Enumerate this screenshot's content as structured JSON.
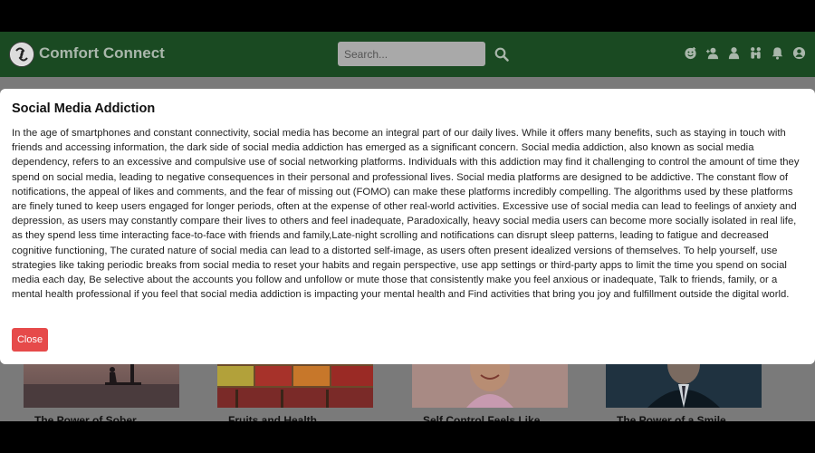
{
  "navbar": {
    "brand": "Comfort Connect",
    "search_placeholder": "Search...",
    "icons": [
      "emoji-icon",
      "add-friend-icon",
      "profile-icon",
      "community-icon",
      "notifications-icon",
      "account-icon"
    ]
  },
  "cards": [
    {
      "title": "The Power of Sober"
    },
    {
      "title": "Fruits and Health"
    },
    {
      "title": "Self Control Feels Like"
    },
    {
      "title": "The Power of a Smile"
    }
  ],
  "modal": {
    "title": "Social Media Addiction",
    "body": "In the age of smartphones and constant connectivity, social media has become an integral part of our daily lives. While it offers many benefits, such as staying in touch with friends and accessing information, the dark side of social media addiction has emerged as a significant concern. Social media addiction, also known as social media dependency, refers to an excessive and compulsive use of social networking platforms. Individuals with this addiction may find it challenging to control the amount of time they spend on social media, leading to negative consequences in their personal and professional lives. Social media platforms are designed to be addictive. The constant flow of notifications, the appeal of likes and comments, and the fear of missing out (FOMO) can make these platforms incredibly compelling. The algorithms used by these platforms are finely tuned to keep users engaged for longer periods, often at the expense of other real-world activities. Excessive use of social media can lead to feelings of anxiety and depression, as users may constantly compare their lives to others and feel inadequate, Paradoxically, heavy social media users can become more socially isolated in real life, as they spend less time interacting face-to-face with friends and family,Late-night scrolling and notifications can disrupt sleep patterns, leading to fatigue and decreased cognitive functioning, The curated nature of social media can lead to a distorted self-image, as users often present idealized versions of themselves. To help yourself, use strategies like taking periodic breaks from social media to reset your habits and regain perspective, use app settings or third-party apps to limit the time you spend on social media each day, Be selective about the accounts you follow and unfollow or mute those that consistently make you feel anxious or inadequate, Talk to friends, family, or a mental health professional if you feel that social media addiction is impacting your mental health and Find activities that bring you joy and fulfillment outside the digital world.",
    "close_label": "Close"
  },
  "colors": {
    "navbar": "#1a4a22",
    "close_button": "#e64a4a",
    "backdrop": "#7a7a7a"
  }
}
